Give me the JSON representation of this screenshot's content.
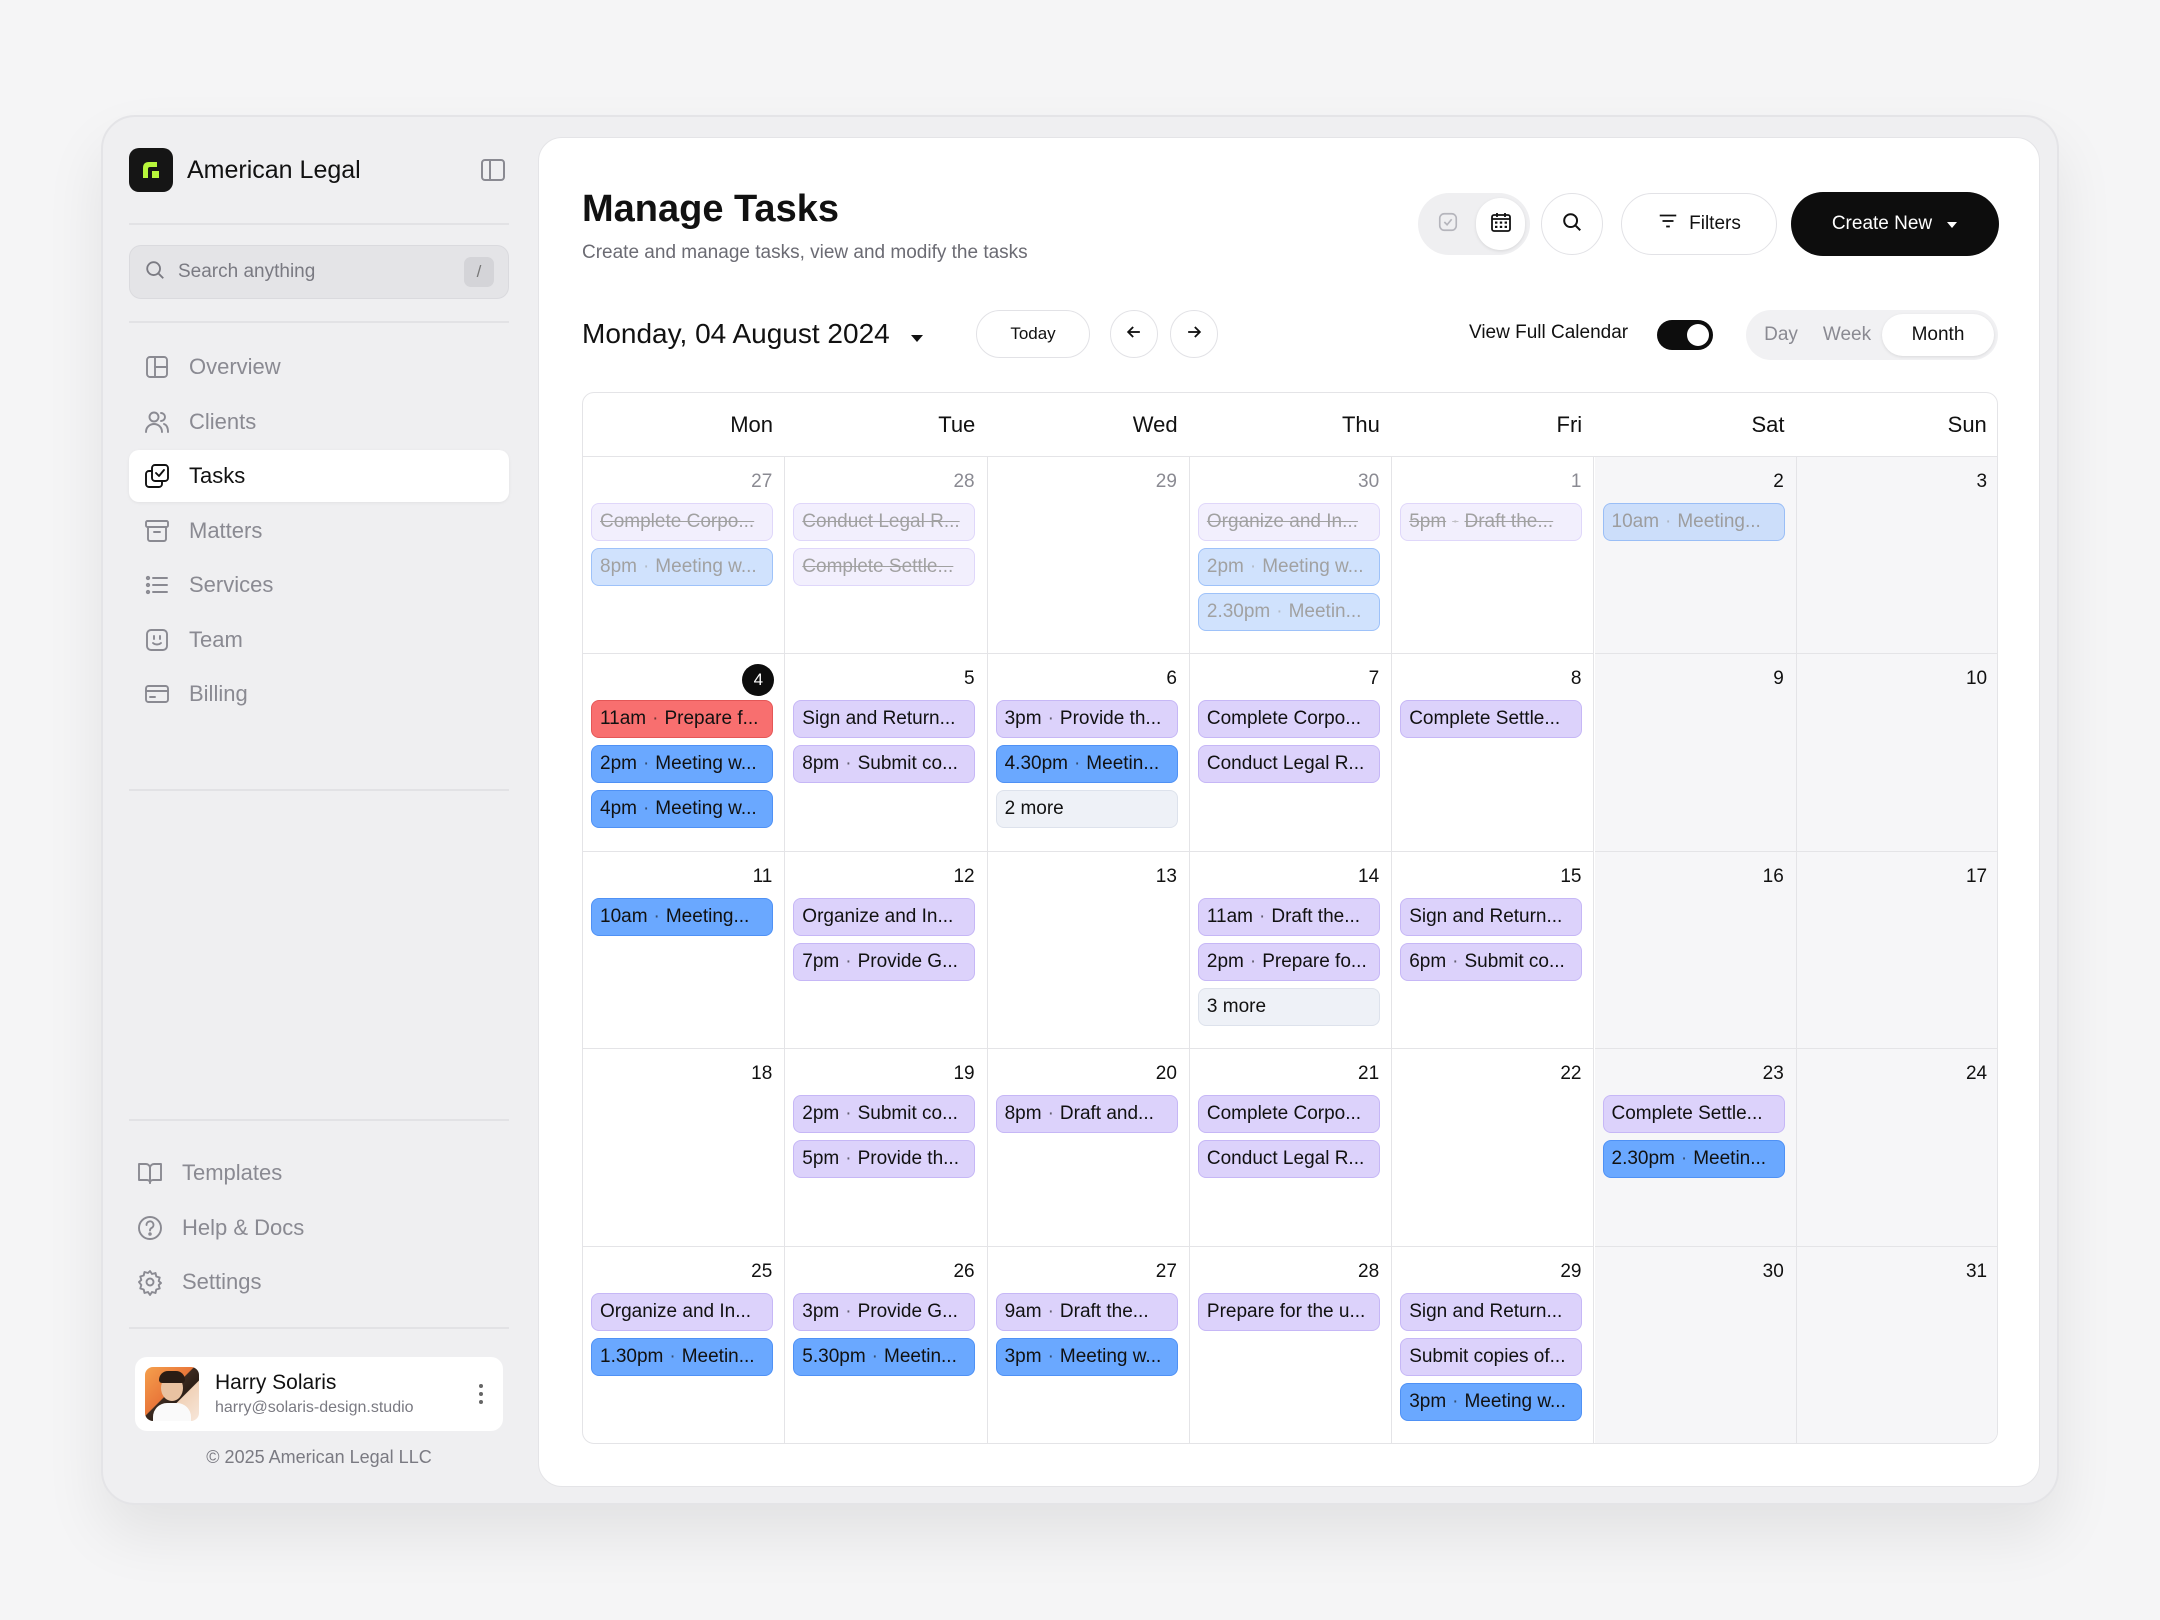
{
  "brand": {
    "name": "American Legal"
  },
  "search": {
    "placeholder": "Search anything",
    "shortcut": "/"
  },
  "nav": {
    "items": [
      {
        "label": "Overview",
        "icon": "layout-icon"
      },
      {
        "label": "Clients",
        "icon": "users-icon"
      },
      {
        "label": "Tasks",
        "icon": "tasks-icon",
        "active": true
      },
      {
        "label": "Matters",
        "icon": "archive-icon"
      },
      {
        "label": "Services",
        "icon": "list-icon"
      },
      {
        "label": "Team",
        "icon": "smile-icon"
      },
      {
        "label": "Billing",
        "icon": "card-icon"
      }
    ],
    "bottom": [
      {
        "label": "Templates",
        "icon": "book-icon"
      },
      {
        "label": "Help & Docs",
        "icon": "help-icon"
      },
      {
        "label": "Settings",
        "icon": "gear-icon"
      }
    ]
  },
  "user": {
    "name": "Harry Solaris",
    "email": "harry@solaris-design.studio"
  },
  "footer": {
    "copyright": "© 2025 American Legal LLC"
  },
  "page": {
    "title": "Manage Tasks",
    "subtitle": "Create and manage tasks, view and modify the tasks"
  },
  "toolbar": {
    "filters_label": "Filters",
    "create_label": "Create New"
  },
  "calendar_controls": {
    "current_date": "Monday, 04 August 2024",
    "today_label": "Today",
    "view_full_calendar_label": "View Full Calendar",
    "view_full_calendar_on": true,
    "views": [
      "Day",
      "Week",
      "Month"
    ],
    "active_view": "Month"
  },
  "calendar": {
    "weekdays": [
      "Mon",
      "Tue",
      "Wed",
      "Thu",
      "Fri",
      "Sat",
      "Sun"
    ],
    "weeks": [
      [
        {
          "day": "27",
          "muted": true,
          "events": [
            {
              "title": "Complete Corpo...",
              "color": "purple",
              "faded": true,
              "done": true
            },
            {
              "time": "8pm",
              "title": "Meeting w...",
              "color": "blue",
              "faded": true
            }
          ]
        },
        {
          "day": "28",
          "muted": true,
          "events": [
            {
              "title": "Conduct Legal R...",
              "color": "purple",
              "faded": true,
              "done": true
            },
            {
              "title": "Complete Settle...",
              "color": "purple",
              "faded": true,
              "done": true
            }
          ]
        },
        {
          "day": "29",
          "muted": true,
          "events": []
        },
        {
          "day": "30",
          "muted": true,
          "events": [
            {
              "title": "Organize and In...",
              "color": "purple",
              "faded": true,
              "done": true
            },
            {
              "time": "2pm",
              "title": "Meeting w...",
              "color": "blue",
              "faded": true
            },
            {
              "time": "2.30pm",
              "title": "Meetin...",
              "color": "blue",
              "faded": true
            }
          ]
        },
        {
          "day": "1",
          "muted": true,
          "events": [
            {
              "time": "5pm",
              "title": "Draft the...",
              "color": "purple",
              "faded": true,
              "done": true
            }
          ]
        },
        {
          "day": "2",
          "events": [
            {
              "time": "10am",
              "title": "Meeting...",
              "color": "blue",
              "faded": true
            }
          ]
        },
        {
          "day": "3",
          "events": []
        }
      ],
      [
        {
          "day": "4",
          "today": true,
          "events": [
            {
              "time": "11am",
              "title": "Prepare f...",
              "color": "red"
            },
            {
              "time": "2pm",
              "title": "Meeting w...",
              "color": "blue"
            },
            {
              "time": "4pm",
              "title": "Meeting w...",
              "color": "blue"
            }
          ]
        },
        {
          "day": "5",
          "events": [
            {
              "title": "Sign and Return...",
              "color": "purple"
            },
            {
              "time": "8pm",
              "title": "Submit co...",
              "color": "purple"
            }
          ]
        },
        {
          "day": "6",
          "events": [
            {
              "time": "3pm",
              "title": "Provide th...",
              "color": "purple"
            },
            {
              "time": "4.30pm",
              "title": "Meetin...",
              "color": "blue"
            },
            {
              "title": "2 more",
              "color": "more"
            }
          ]
        },
        {
          "day": "7",
          "events": [
            {
              "title": "Complete Corpo...",
              "color": "purple"
            },
            {
              "title": "Conduct Legal R...",
              "color": "purple"
            }
          ]
        },
        {
          "day": "8",
          "events": [
            {
              "title": "Complete Settle...",
              "color": "purple"
            }
          ]
        },
        {
          "day": "9",
          "events": []
        },
        {
          "day": "10",
          "events": []
        }
      ],
      [
        {
          "day": "11",
          "events": [
            {
              "time": "10am",
              "title": "Meeting...",
              "color": "blue"
            }
          ]
        },
        {
          "day": "12",
          "events": [
            {
              "title": "Organize and In...",
              "color": "purple"
            },
            {
              "time": "7pm",
              "title": "Provide G...",
              "color": "purple"
            }
          ]
        },
        {
          "day": "13",
          "events": []
        },
        {
          "day": "14",
          "events": [
            {
              "time": "11am",
              "title": "Draft the...",
              "color": "purple"
            },
            {
              "time": "2pm",
              "title": "Prepare fo...",
              "color": "purple"
            },
            {
              "title": "3 more",
              "color": "more"
            }
          ]
        },
        {
          "day": "15",
          "events": [
            {
              "title": "Sign and Return...",
              "color": "purple"
            },
            {
              "time": "6pm",
              "title": "Submit co...",
              "color": "purple"
            }
          ]
        },
        {
          "day": "16",
          "events": []
        },
        {
          "day": "17",
          "events": []
        }
      ],
      [
        {
          "day": "18",
          "events": []
        },
        {
          "day": "19",
          "events": [
            {
              "time": "2pm",
              "title": "Submit co...",
              "color": "purple"
            },
            {
              "time": "5pm",
              "title": "Provide th...",
              "color": "purple"
            }
          ]
        },
        {
          "day": "20",
          "events": [
            {
              "time": "8pm",
              "title": "Draft and...",
              "color": "purple"
            }
          ]
        },
        {
          "day": "21",
          "events": [
            {
              "title": "Complete Corpo...",
              "color": "purple"
            },
            {
              "title": "Conduct Legal R...",
              "color": "purple"
            }
          ]
        },
        {
          "day": "22",
          "events": []
        },
        {
          "day": "23",
          "events": [
            {
              "title": "Complete Settle...",
              "color": "purple"
            },
            {
              "time": "2.30pm",
              "title": "Meetin...",
              "color": "blue"
            }
          ]
        },
        {
          "day": "24",
          "events": []
        }
      ],
      [
        {
          "day": "25",
          "events": [
            {
              "title": "Organize and In...",
              "color": "purple"
            },
            {
              "time": "1.30pm",
              "title": "Meetin...",
              "color": "blue"
            }
          ]
        },
        {
          "day": "26",
          "events": [
            {
              "time": "3pm",
              "title": "Provide G...",
              "color": "purple"
            },
            {
              "time": "5.30pm",
              "title": "Meetin...",
              "color": "blue"
            }
          ]
        },
        {
          "day": "27",
          "events": [
            {
              "time": "9am",
              "title": "Draft the...",
              "color": "purple"
            },
            {
              "time": "3pm",
              "title": "Meeting w...",
              "color": "blue"
            }
          ]
        },
        {
          "day": "28",
          "events": [
            {
              "title": "Prepare for the u...",
              "color": "purple"
            }
          ]
        },
        {
          "day": "29",
          "events": [
            {
              "title": "Sign and Return...",
              "color": "purple"
            },
            {
              "title": "Submit copies of...",
              "color": "purple"
            },
            {
              "time": "3pm",
              "title": "Meeting w...",
              "color": "blue"
            }
          ]
        },
        {
          "day": "30",
          "events": []
        },
        {
          "day": "31",
          "events": []
        }
      ]
    ]
  }
}
